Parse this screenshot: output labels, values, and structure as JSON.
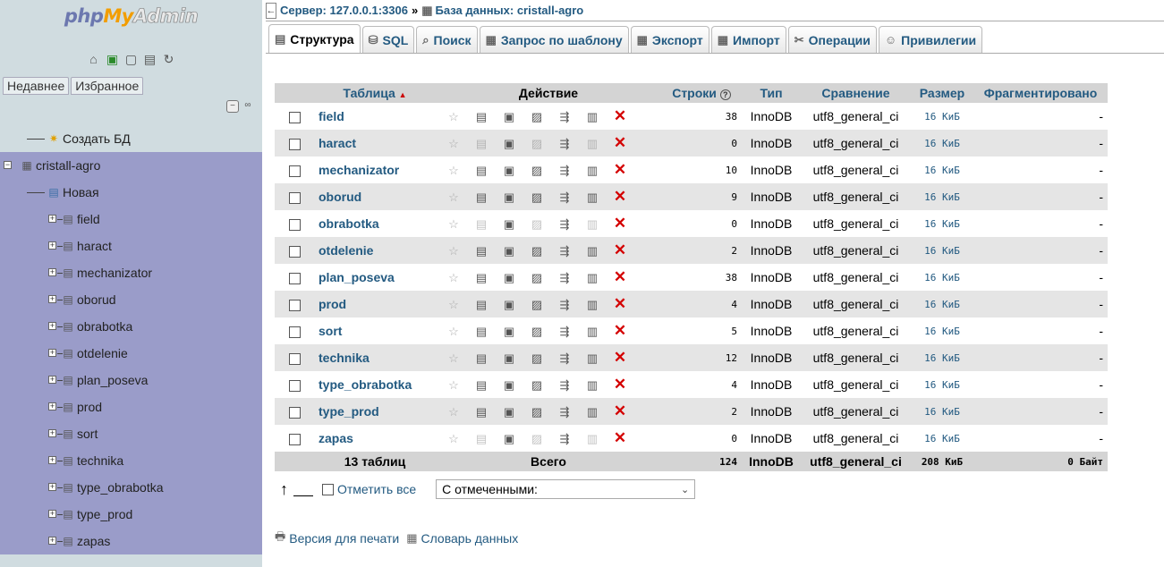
{
  "nav": {
    "logo": {
      "php": "php",
      "my": "My",
      "admin": "Admin"
    },
    "icons": [
      "home-icon",
      "exit-icon",
      "query-window-icon",
      "docs-icon",
      "reload-icon"
    ],
    "tabs": [
      "Недавнее",
      "Избранное"
    ],
    "create_db": "Создать БД",
    "database": "cristall-agro",
    "new_table": "Новая",
    "tables": [
      "field",
      "haract",
      "mechanizator",
      "oborud",
      "obrabotka",
      "otdelenie",
      "plan_poseva",
      "prod",
      "sort",
      "technika",
      "type_obrabotka",
      "type_prod",
      "zapas"
    ]
  },
  "breadcrumb": {
    "server": "Сервер: 127.0.0.1:3306",
    "separator": "»",
    "database": "База данных: cristall-agro"
  },
  "tabs": [
    {
      "label": "Структура",
      "icon": "structure-icon",
      "active": true
    },
    {
      "label": "SQL",
      "icon": "sql-icon"
    },
    {
      "label": "Поиск",
      "icon": "search-icon"
    },
    {
      "label": "Запрос по шаблону",
      "icon": "query-icon"
    },
    {
      "label": "Экспорт",
      "icon": "export-icon"
    },
    {
      "label": "Импорт",
      "icon": "import-icon"
    },
    {
      "label": "Операции",
      "icon": "operations-icon"
    },
    {
      "label": "Привилегии",
      "icon": "privileges-icon"
    }
  ],
  "table": {
    "headers": {
      "table": "Таблица",
      "sort_indicator": "▲",
      "action": "Действие",
      "rows": "Строки",
      "rows_help": "?",
      "type": "Тип",
      "collation": "Сравнение",
      "size": "Размер",
      "overhead": "Фрагментировано"
    },
    "rows": [
      {
        "name": "field",
        "rows": "38",
        "type": "InnoDB",
        "collation": "utf8_general_ci",
        "size": "16 КиБ",
        "overhead": "-",
        "empty": false
      },
      {
        "name": "haract",
        "rows": "0",
        "type": "InnoDB",
        "collation": "utf8_general_ci",
        "size": "16 КиБ",
        "overhead": "-",
        "empty": true
      },
      {
        "name": "mechanizator",
        "rows": "10",
        "type": "InnoDB",
        "collation": "utf8_general_ci",
        "size": "16 КиБ",
        "overhead": "-",
        "empty": false
      },
      {
        "name": "oborud",
        "rows": "9",
        "type": "InnoDB",
        "collation": "utf8_general_ci",
        "size": "16 КиБ",
        "overhead": "-",
        "empty": false
      },
      {
        "name": "obrabotka",
        "rows": "0",
        "type": "InnoDB",
        "collation": "utf8_general_ci",
        "size": "16 КиБ",
        "overhead": "-",
        "empty": true
      },
      {
        "name": "otdelenie",
        "rows": "2",
        "type": "InnoDB",
        "collation": "utf8_general_ci",
        "size": "16 КиБ",
        "overhead": "-",
        "empty": false
      },
      {
        "name": "plan_poseva",
        "rows": "38",
        "type": "InnoDB",
        "collation": "utf8_general_ci",
        "size": "16 КиБ",
        "overhead": "-",
        "empty": false
      },
      {
        "name": "prod",
        "rows": "4",
        "type": "InnoDB",
        "collation": "utf8_general_ci",
        "size": "16 КиБ",
        "overhead": "-",
        "empty": false
      },
      {
        "name": "sort",
        "rows": "5",
        "type": "InnoDB",
        "collation": "utf8_general_ci",
        "size": "16 КиБ",
        "overhead": "-",
        "empty": false
      },
      {
        "name": "technika",
        "rows": "12",
        "type": "InnoDB",
        "collation": "utf8_general_ci",
        "size": "16 КиБ",
        "overhead": "-",
        "empty": false
      },
      {
        "name": "type_obrabotka",
        "rows": "4",
        "type": "InnoDB",
        "collation": "utf8_general_ci",
        "size": "16 КиБ",
        "overhead": "-",
        "empty": false
      },
      {
        "name": "type_prod",
        "rows": "2",
        "type": "InnoDB",
        "collation": "utf8_general_ci",
        "size": "16 КиБ",
        "overhead": "-",
        "empty": false
      },
      {
        "name": "zapas",
        "rows": "0",
        "type": "InnoDB",
        "collation": "utf8_general_ci",
        "size": "16 КиБ",
        "overhead": "-",
        "empty": true
      }
    ],
    "footer": {
      "count": "13 таблиц",
      "total_label": "Всего",
      "rows": "124",
      "type": "InnoDB",
      "collation": "utf8_general_ci",
      "size": "208 КиБ",
      "overhead": "0 Байт"
    }
  },
  "bulk": {
    "check_all": "Отметить все",
    "with_selected": "С отмеченными:"
  },
  "links": {
    "print": "Версия для печати",
    "dictionary": "Словарь данных"
  },
  "colors": {
    "link": "#235a81",
    "nav_bg": "#d0dce0",
    "db_highlight": "#9a9cc9",
    "drop": "#d40000"
  }
}
